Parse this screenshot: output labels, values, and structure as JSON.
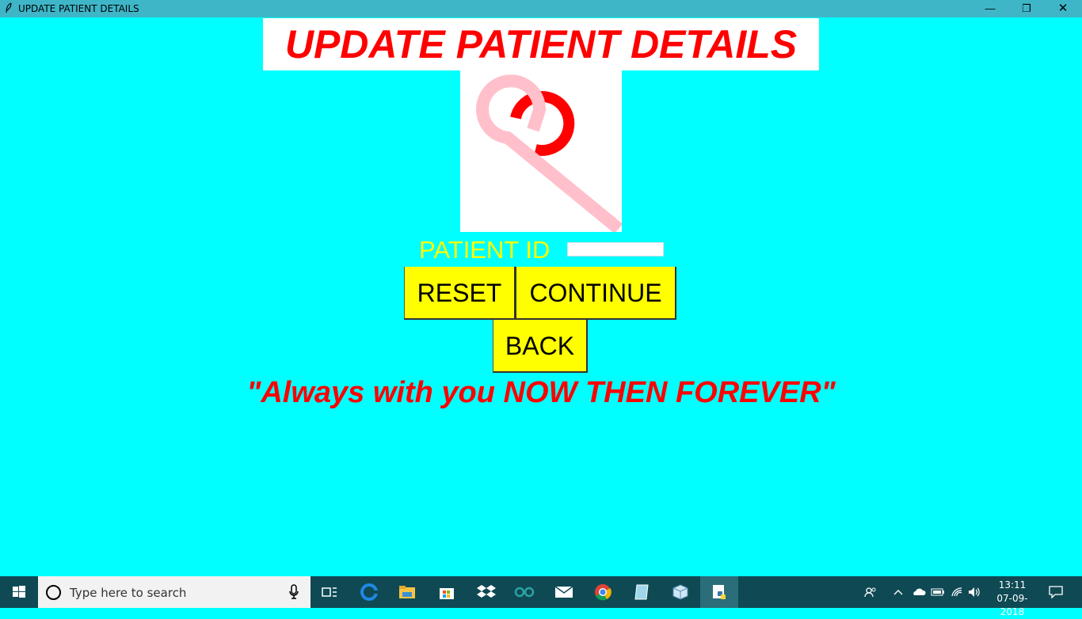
{
  "window": {
    "title": "UPDATE PATIENT DETAILS",
    "minimize_glyph": "—",
    "maximize_glyph": "❐",
    "close_glyph": "✕"
  },
  "page": {
    "heading": "UPDATE PATIENT DETAILS",
    "patient_id_label": "PATIENT ID",
    "patient_id_value": "",
    "reset_label": "RESET",
    "continue_label": "CONTINUE",
    "back_label": "BACK",
    "tagline": "\"Always with you NOW THEN FOREVER\""
  },
  "colors": {
    "background": "#00ffff",
    "heading_text": "#ff0000",
    "button_bg": "#ffff00",
    "label_text": "#ffff00",
    "logo_ribbon": "#ffc0cb",
    "logo_accent": "#ff0000"
  },
  "taskbar": {
    "search_placeholder": "Type here to search",
    "apps": [
      "task-view",
      "edge",
      "file-explorer",
      "store",
      "dropbox",
      "arduino",
      "mail",
      "chrome",
      "notepad",
      "virtualbox",
      "python-idle"
    ],
    "time": "13:11",
    "date": "07-09-2018"
  }
}
